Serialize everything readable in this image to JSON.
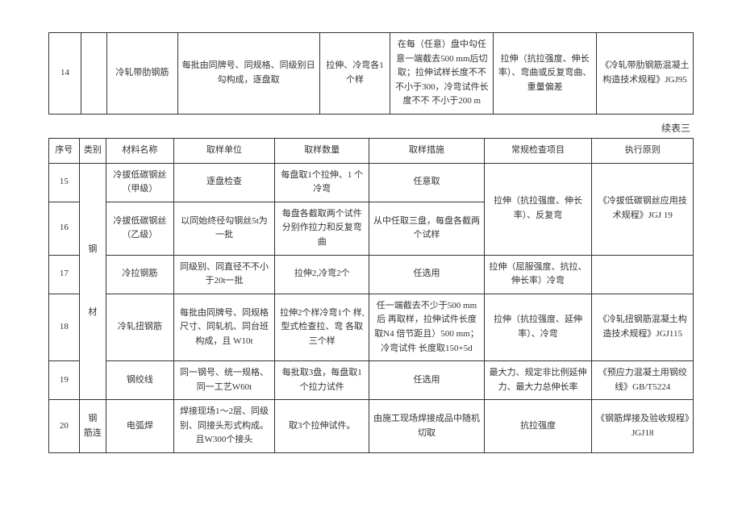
{
  "table1": {
    "row": {
      "seq": "14",
      "cat": "",
      "name": "冷轧带肋钢筋",
      "unit": "每批由同牌号、同规格、同级别日勾构成，逐盘取",
      "qty": "拉伸、冷弯各1 个样",
      "measure": "在每（任意）盘中勾任意一端截去500 mm后切取；拉伸试样长度不不不小于300，冷弯试件长度不不 不小于200 m",
      "check": "拉伸（抗拉强度、伸长 率）、弯曲或反复弯曲、 重量偏差",
      "rule": "《冷轧带肋钢筋混凝土构造技术规程》JGJ95"
    }
  },
  "continuation": "续表三",
  "table2": {
    "headers": {
      "seq": "序号",
      "cat": "类别",
      "name": "材料名称",
      "unit": "取样单位",
      "qty": "取样数量",
      "measure": "取样措施",
      "check": "常规检查项目",
      "rule": "执行原则"
    },
    "cat1": "钢",
    "cat2": "材",
    "cat3": "钢 筋连",
    "rows": [
      {
        "seq": "15",
        "name": "冷拔低碳钢丝（甲级）",
        "unit": "逐盘检查",
        "qty": "每盘取1个拉伸、1 个冷弯",
        "measure": "任意取",
        "check_merge": "拉伸（抗拉强度、伸长率）、反复弯",
        "rule_merge": "《冷拔低碳钢丝应用技术规程》JGJ 19"
      },
      {
        "seq": "16",
        "name": "冷拔低碳钢丝（乙级）",
        "unit": "以同始终径勾钢丝5t为 一批",
        "qty": "每盘各截取两个试件分别作拉力和反复弯曲",
        "measure": "从中任取三盘，每盘各截两个试样"
      },
      {
        "seq": "17",
        "name": "冷拉钢筋",
        "unit": "同级别、同直径不不小于20t一批",
        "qty": "拉伸2,冷弯2个",
        "measure": "任选用",
        "check": "拉伸（屈服强度、抗拉、 伸长率）冷弯",
        "rule": ""
      },
      {
        "seq": "18",
        "name": "冷轧扭钢筋",
        "unit": "每批由同牌号、同规格尺寸、同轧机、同台班构成，且 W10t",
        "qty": "拉伸2个样冷弯1个 样,型式检查拉、弯 各取三个样",
        "measure": "任一端截去不少于500 mm后 再取样，拉伸试件长度取N4 倍节距且）500 mm；冷弯试件 长度取150+5d",
        "check": "拉伸（抗拉强度、延伸率）、冷弯",
        "rule": "《冷轧扭钢筋混凝土构 造技术规程》JGJ115"
      },
      {
        "seq": "19",
        "name": "钢绞线",
        "unit": "同一钢号、统一规格、同一工艺W60t",
        "qty": "每批取3盘，每盘取1个拉力试件",
        "measure": "任选用",
        "check": "最大力、规定非比例延伸力、最大力总伸长率",
        "rule": "《预应力混凝土用钢绞线》GB/T5224"
      },
      {
        "seq": "20",
        "name": "电弧焊",
        "unit": "焊接现场1～2层、同级 别、同接头形式构成。且W300个接头",
        "qty": "取3个拉伸试件。",
        "measure": "由施工现场焊接成品中随机 切取",
        "check": "抗拉强度",
        "rule": "《钢筋焊接及验收规程》JGJ18"
      }
    ]
  }
}
